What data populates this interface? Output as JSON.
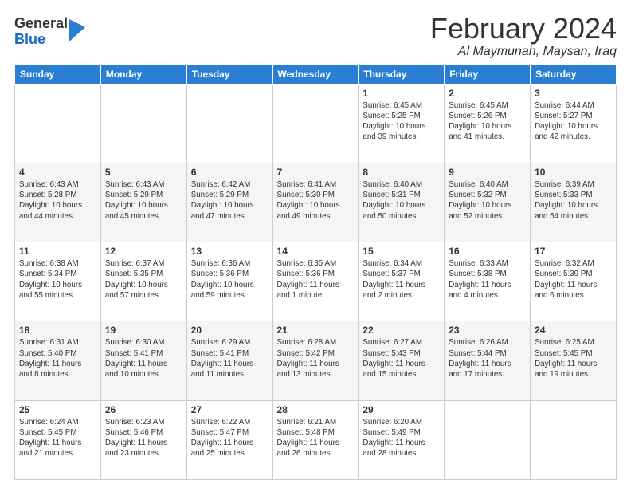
{
  "logo": {
    "general": "General",
    "blue": "Blue"
  },
  "title": "February 2024",
  "location": "Al Maymunah, Maysan, Iraq",
  "weekdays": [
    "Sunday",
    "Monday",
    "Tuesday",
    "Wednesday",
    "Thursday",
    "Friday",
    "Saturday"
  ],
  "weeks": [
    [
      {
        "day": "",
        "info": ""
      },
      {
        "day": "",
        "info": ""
      },
      {
        "day": "",
        "info": ""
      },
      {
        "day": "",
        "info": ""
      },
      {
        "day": "1",
        "info": "Sunrise: 6:45 AM\nSunset: 5:25 PM\nDaylight: 10 hours\nand 39 minutes."
      },
      {
        "day": "2",
        "info": "Sunrise: 6:45 AM\nSunset: 5:26 PM\nDaylight: 10 hours\nand 41 minutes."
      },
      {
        "day": "3",
        "info": "Sunrise: 6:44 AM\nSunset: 5:27 PM\nDaylight: 10 hours\nand 42 minutes."
      }
    ],
    [
      {
        "day": "4",
        "info": "Sunrise: 6:43 AM\nSunset: 5:28 PM\nDaylight: 10 hours\nand 44 minutes."
      },
      {
        "day": "5",
        "info": "Sunrise: 6:43 AM\nSunset: 5:29 PM\nDaylight: 10 hours\nand 45 minutes."
      },
      {
        "day": "6",
        "info": "Sunrise: 6:42 AM\nSunset: 5:29 PM\nDaylight: 10 hours\nand 47 minutes."
      },
      {
        "day": "7",
        "info": "Sunrise: 6:41 AM\nSunset: 5:30 PM\nDaylight: 10 hours\nand 49 minutes."
      },
      {
        "day": "8",
        "info": "Sunrise: 6:40 AM\nSunset: 5:31 PM\nDaylight: 10 hours\nand 50 minutes."
      },
      {
        "day": "9",
        "info": "Sunrise: 6:40 AM\nSunset: 5:32 PM\nDaylight: 10 hours\nand 52 minutes."
      },
      {
        "day": "10",
        "info": "Sunrise: 6:39 AM\nSunset: 5:33 PM\nDaylight: 10 hours\nand 54 minutes."
      }
    ],
    [
      {
        "day": "11",
        "info": "Sunrise: 6:38 AM\nSunset: 5:34 PM\nDaylight: 10 hours\nand 55 minutes."
      },
      {
        "day": "12",
        "info": "Sunrise: 6:37 AM\nSunset: 5:35 PM\nDaylight: 10 hours\nand 57 minutes."
      },
      {
        "day": "13",
        "info": "Sunrise: 6:36 AM\nSunset: 5:36 PM\nDaylight: 10 hours\nand 59 minutes."
      },
      {
        "day": "14",
        "info": "Sunrise: 6:35 AM\nSunset: 5:36 PM\nDaylight: 11 hours\nand 1 minute."
      },
      {
        "day": "15",
        "info": "Sunrise: 6:34 AM\nSunset: 5:37 PM\nDaylight: 11 hours\nand 2 minutes."
      },
      {
        "day": "16",
        "info": "Sunrise: 6:33 AM\nSunset: 5:38 PM\nDaylight: 11 hours\nand 4 minutes."
      },
      {
        "day": "17",
        "info": "Sunrise: 6:32 AM\nSunset: 5:39 PM\nDaylight: 11 hours\nand 6 minutes."
      }
    ],
    [
      {
        "day": "18",
        "info": "Sunrise: 6:31 AM\nSunset: 5:40 PM\nDaylight: 11 hours\nand 8 minutes."
      },
      {
        "day": "19",
        "info": "Sunrise: 6:30 AM\nSunset: 5:41 PM\nDaylight: 11 hours\nand 10 minutes."
      },
      {
        "day": "20",
        "info": "Sunrise: 6:29 AM\nSunset: 5:41 PM\nDaylight: 11 hours\nand 11 minutes."
      },
      {
        "day": "21",
        "info": "Sunrise: 6:28 AM\nSunset: 5:42 PM\nDaylight: 11 hours\nand 13 minutes."
      },
      {
        "day": "22",
        "info": "Sunrise: 6:27 AM\nSunset: 5:43 PM\nDaylight: 11 hours\nand 15 minutes."
      },
      {
        "day": "23",
        "info": "Sunrise: 6:26 AM\nSunset: 5:44 PM\nDaylight: 11 hours\nand 17 minutes."
      },
      {
        "day": "24",
        "info": "Sunrise: 6:25 AM\nSunset: 5:45 PM\nDaylight: 11 hours\nand 19 minutes."
      }
    ],
    [
      {
        "day": "25",
        "info": "Sunrise: 6:24 AM\nSunset: 5:45 PM\nDaylight: 11 hours\nand 21 minutes."
      },
      {
        "day": "26",
        "info": "Sunrise: 6:23 AM\nSunset: 5:46 PM\nDaylight: 11 hours\nand 23 minutes."
      },
      {
        "day": "27",
        "info": "Sunrise: 6:22 AM\nSunset: 5:47 PM\nDaylight: 11 hours\nand 25 minutes."
      },
      {
        "day": "28",
        "info": "Sunrise: 6:21 AM\nSunset: 5:48 PM\nDaylight: 11 hours\nand 26 minutes."
      },
      {
        "day": "29",
        "info": "Sunrise: 6:20 AM\nSunset: 5:49 PM\nDaylight: 11 hours\nand 28 minutes."
      },
      {
        "day": "",
        "info": ""
      },
      {
        "day": "",
        "info": ""
      }
    ]
  ]
}
